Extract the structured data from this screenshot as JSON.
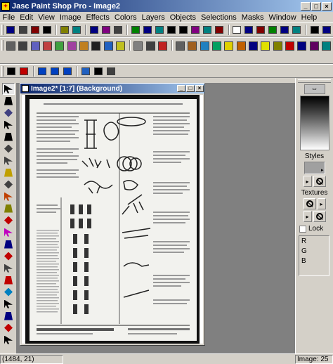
{
  "window": {
    "title": "Jasc Paint Shop Pro - Image2",
    "min": "_",
    "max": "□",
    "close": "×"
  },
  "menu": [
    "File",
    "Edit",
    "View",
    "Image",
    "Effects",
    "Colors",
    "Layers",
    "Objects",
    "Selections",
    "Masks",
    "Window",
    "Help"
  ],
  "toolbar1": {
    "icons": [
      "new-icon",
      "open-icon",
      "save-icon",
      "print-icon",
      "undo-icon",
      "redo-icon",
      "cut-icon",
      "copy-icon",
      "paste-icon",
      "selection-icon",
      "rotate-icon",
      "flip-icon",
      "image-info-icon",
      "page-icon",
      "browse-icon",
      "screen-icon",
      "save-as-icon",
      "zoom-icon",
      "magnify-icon",
      "histogram-icon",
      "palette-icon",
      "layer-palette-icon",
      "overview-icon",
      "lock-icon",
      "help-icon"
    ],
    "colors": [
      "#000080",
      "#404040",
      "#800000",
      "#000000",
      "#808000",
      "#008080",
      "#000080",
      "#800080",
      "#404040",
      "#008000",
      "#000080",
      "#008080",
      "#000000",
      "#000000",
      "#800080",
      "#008080",
      "#800000",
      "#ffffff",
      "#000080",
      "#800000",
      "#008000",
      "#000080",
      "#008080",
      "#000000",
      "#000080"
    ]
  },
  "toolbar2": {
    "icons": [
      "effect-1-icon",
      "effect-2-icon",
      "effect-3-icon",
      "effect-4-icon",
      "effect-5-icon",
      "effect-6-icon",
      "effect-7-icon",
      "effect-8-icon",
      "effect-9-icon",
      "effect-10-icon",
      "effect-11-icon",
      "effect-12-icon",
      "effect-13-icon",
      "effect-14-icon",
      "effect-15-icon",
      "effect-16-icon",
      "effect-17-icon",
      "effect-18-icon",
      "effect-19-icon",
      "effect-20-icon",
      "effect-21-icon",
      "effect-22-icon",
      "effect-23-icon",
      "effect-24-icon",
      "effect-25-icon",
      "effect-26-icon"
    ],
    "colors": [
      "#606060",
      "#404040",
      "#6060c0",
      "#c04040",
      "#40a040",
      "#a040a0",
      "#c08020",
      "#202020",
      "#2060c0",
      "#c0c020",
      "#808080",
      "#404040",
      "#c02020",
      "#606060",
      "#a06020",
      "#2080c0",
      "#00a060",
      "#e0d000",
      "#c06000",
      "#000080",
      "#e0e000",
      "#808000",
      "#c00000",
      "#000080",
      "#600060",
      "#008080"
    ]
  },
  "toolbar3": {
    "icons": [
      "move-icon",
      "deform-icon",
      "arrow-left-icon",
      "arrow-right-icon",
      "arrow-out-icon",
      "globe-icon",
      "grid-icon",
      "overlay-icon"
    ],
    "colors": [
      "#000000",
      "#c00000",
      "#0040c0",
      "#0040c0",
      "#0040c0",
      "#2060c0",
      "#000000",
      "#404040"
    ]
  },
  "tools": [
    "arrow-tool-icon",
    "zoom-tool-icon",
    "deform-tool-icon",
    "crop-tool-icon",
    "move-tool-icon",
    "selection-tool-icon",
    "freehand-tool-icon",
    "magic-wand-tool-icon",
    "dropper-tool-icon",
    "paintbrush-tool-icon",
    "clone-tool-icon",
    "color-replacer-tool-icon",
    "retouch-tool-icon",
    "scratch-remover-tool-icon",
    "eraser-tool-icon",
    "picture-tube-tool-icon",
    "airbrush-tool-icon",
    "flood-fill-tool-icon",
    "text-tool-icon",
    "draw-tool-icon",
    "preset-shapes-tool-icon",
    "object-selector-tool-icon"
  ],
  "toolColors": [
    "#000000",
    "#000000",
    "#404080",
    "#000000",
    "#000000",
    "#404040",
    "#404040",
    "#c0a000",
    "#404040",
    "#c04000",
    "#808000",
    "#c00000",
    "#c000c0",
    "#000080",
    "#c00000",
    "#404040",
    "#c00000",
    "#0080c0",
    "#000000",
    "#000080",
    "#c00000",
    "#000000"
  ],
  "document": {
    "title": "Image2* [1:7] (Background)"
  },
  "palette": {
    "styles": "Styles",
    "textures": "Textures",
    "lock": "Lock",
    "r": "R",
    "g": "G",
    "b": "B",
    "arrow": "⇔"
  },
  "status": {
    "left": "(1484, 21)",
    "right": "Image: 25"
  }
}
